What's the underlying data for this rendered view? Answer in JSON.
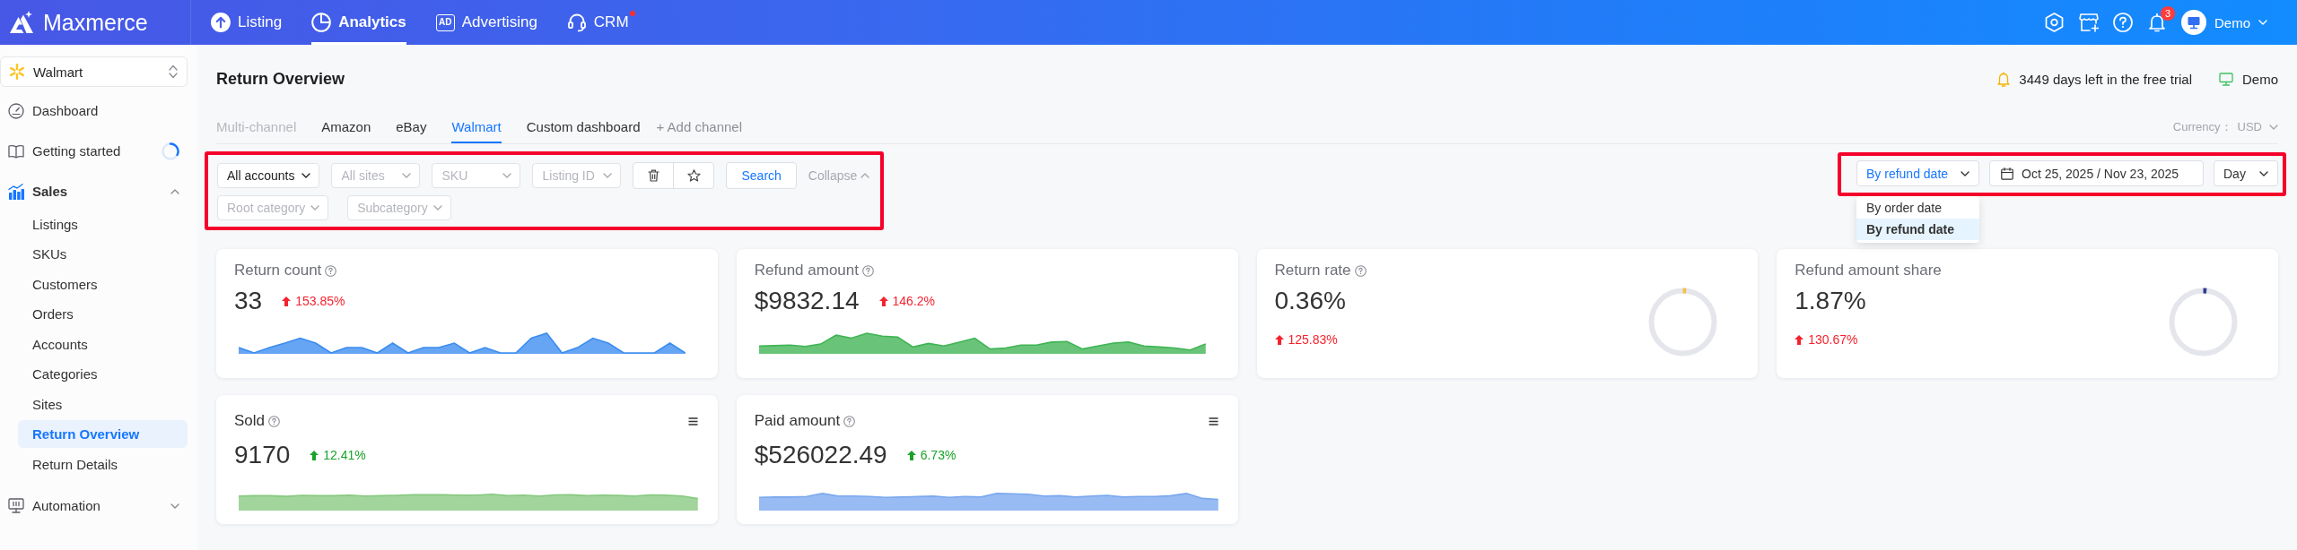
{
  "top_nav": {
    "brand": "Maxmerce",
    "items": [
      {
        "label": "Listing",
        "selected": false,
        "notify": false
      },
      {
        "label": "Analytics",
        "selected": true,
        "notify": false
      },
      {
        "label": "Advertising",
        "icon_text": "AD",
        "selected": false,
        "notify": false
      },
      {
        "label": "CRM",
        "selected": false,
        "notify": true
      }
    ],
    "notification_count": "3",
    "user": "Demo"
  },
  "sidebar": {
    "store": "Walmart",
    "items": [
      {
        "label": "Dashboard",
        "kind": "link",
        "selected": false
      },
      {
        "label": "Getting started",
        "kind": "loading",
        "selected": false
      },
      {
        "label": "Sales",
        "kind": "group",
        "selected": false,
        "expanded": true,
        "children": [
          {
            "label": "Listings",
            "selected": false
          },
          {
            "label": "SKUs",
            "selected": false
          },
          {
            "label": "Customers",
            "selected": false
          },
          {
            "label": "Orders",
            "selected": false
          },
          {
            "label": "Accounts",
            "selected": false
          },
          {
            "label": "Categories",
            "selected": false
          },
          {
            "label": "Sites",
            "selected": false
          },
          {
            "label": "Return Overview",
            "selected": true
          },
          {
            "label": "Return Details",
            "selected": false
          }
        ]
      },
      {
        "label": "Automation",
        "kind": "group",
        "selected": false,
        "expanded": false
      }
    ]
  },
  "header": {
    "title": "Return Overview",
    "trial": "3449 days left in the free trial",
    "account": "Demo"
  },
  "channel_tabs": {
    "tabs": [
      {
        "label": "Multi-channel",
        "selected": false,
        "disabled": true
      },
      {
        "label": "Amazon",
        "selected": false,
        "disabled": false
      },
      {
        "label": "eBay",
        "selected": false,
        "disabled": false
      },
      {
        "label": "Walmart",
        "selected": true,
        "disabled": false
      },
      {
        "label": "Custom dashboard",
        "selected": false,
        "disabled": false
      }
    ],
    "add_channel": "+ Add channel",
    "currency_label": "Currency：",
    "currency": "USD"
  },
  "filters": {
    "highlighted": true,
    "row1": [
      {
        "value": "All accounts"
      },
      {
        "placeholder": "All sites"
      },
      {
        "placeholder": "SKU"
      },
      {
        "placeholder": "Listing ID"
      }
    ],
    "search": "Search",
    "collapse": "Collapse",
    "row2": [
      {
        "placeholder": "Root category"
      },
      {
        "placeholder": "Subcategory"
      }
    ]
  },
  "date_controls": {
    "highlighted": true,
    "date_type": {
      "value": "By refund date",
      "expanded": true,
      "options": [
        {
          "label": "By order date",
          "selected": false
        },
        {
          "label": "By refund date",
          "selected": true
        }
      ]
    },
    "range": "Oct 25, 2025 / Nov 23, 2025",
    "granularity": "Day"
  },
  "card_rows": [
    {
      "cards": [
        {
          "kind": "trend",
          "title": "Return count",
          "help": true,
          "value": "33",
          "delta": {
            "text": "153.85%",
            "color": "#f5222d"
          },
          "sparkline": {
            "color": "#3b8cf0"
          }
        },
        {
          "kind": "trend",
          "title": "Refund amount",
          "help": true,
          "value": "$9832.14",
          "delta": {
            "text": "146.2%",
            "color": "#f5222d"
          },
          "sparkline": {
            "color": "#3fb453"
          }
        },
        {
          "kind": "gauge",
          "title": "Return rate",
          "help": true,
          "value": "0.36%",
          "delta": {
            "text": "125.83%",
            "color": "#f5222d"
          },
          "gauge": {
            "color": "#f5c04a"
          }
        },
        {
          "kind": "gauge",
          "title": "Refund amount share",
          "help": false,
          "value": "1.87%",
          "delta": {
            "text": "130.67%",
            "color": "#f5222d"
          },
          "gauge": {
            "color": "#2e3f8f"
          }
        }
      ]
    },
    {
      "cards": [
        {
          "kind": "summary",
          "title": "Sold",
          "help": true,
          "value": "9170",
          "delta": {
            "text": "12.41%",
            "color": "#1aa329"
          },
          "sparkline": {
            "color": "#86c97f"
          }
        },
        {
          "kind": "summary",
          "title": "Paid amount",
          "help": true,
          "value": "$526022.49",
          "delta": {
            "text": "6.73%",
            "color": "#1aa329"
          },
          "sparkline": {
            "color": "#7aa8ee"
          }
        }
      ]
    }
  ]
}
